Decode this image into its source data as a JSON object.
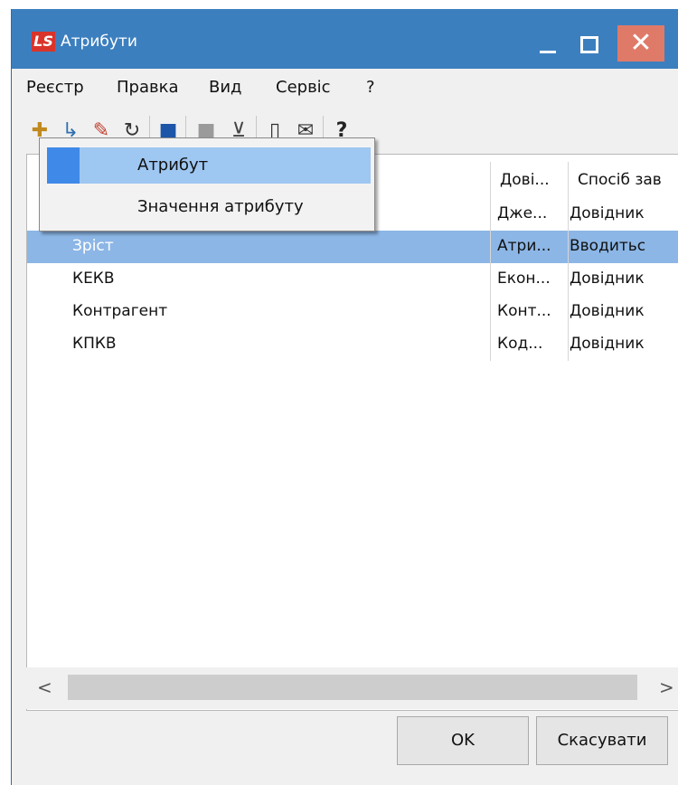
{
  "window": {
    "title": "Атрибути",
    "logo": "LS",
    "close_glyph": "✕"
  },
  "menu": [
    "Реєстр",
    "Правка",
    "Вид",
    "Сервіс",
    "?"
  ],
  "toolbar_icons": [
    "add-icon",
    "add-child-icon",
    "edit-icon",
    "refresh-icon",
    "save-icon",
    "disabled-icon",
    "filter-clear-icon",
    "document-icon",
    "mail-icon",
    "help-icon"
  ],
  "table": {
    "columns": [
      "Дові...",
      "Спосіб зав"
    ],
    "rows": [
      {
        "name": "",
        "c2": "Дже...",
        "c3": "Довідник",
        "selected": false
      },
      {
        "name": "Зріст",
        "c2": "Атри...",
        "c3": "Вводитьс",
        "selected": true
      },
      {
        "name": "КЕКВ",
        "c2": "Екон...",
        "c3": "Довідник",
        "selected": false
      },
      {
        "name": "Контрагент",
        "c2": "Конт...",
        "c3": "Довідник",
        "selected": false
      },
      {
        "name": "КПКВ",
        "c2": "Код...",
        "c3": "Довідник",
        "selected": false
      }
    ]
  },
  "popup_menu": {
    "items": [
      "Атрибут",
      "Значення атрибуту"
    ],
    "active_index": 0
  },
  "buttons": {
    "ok": "OK",
    "cancel": "Скасувати"
  },
  "scrollbar": {
    "left": "<",
    "right": ">"
  },
  "colors": {
    "titlebar": "#3c7fbf",
    "selection": "#8cb6e6",
    "close": "#e07a68",
    "popup_active": "#9ec7f2"
  }
}
